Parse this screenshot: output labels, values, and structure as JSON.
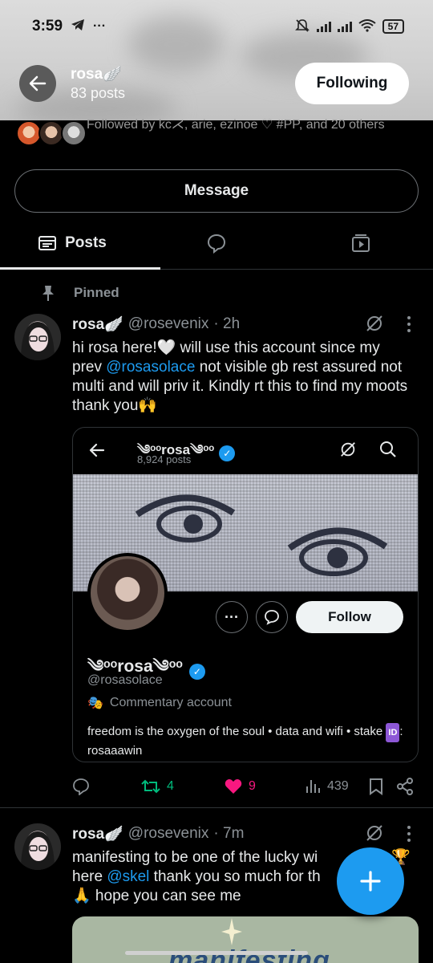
{
  "status_bar": {
    "time": "3:59",
    "battery": "57"
  },
  "header": {
    "name": "rosa🪽",
    "posts_count": "83 posts",
    "following_label": "Following"
  },
  "followed_by": {
    "text": "Followed by kc⋌, arie, ezinoe ♡ #PP, and 20 others"
  },
  "message_label": "Message",
  "tabs": [
    {
      "label": "Posts",
      "active": true
    }
  ],
  "pinned_label": "Pinned",
  "post1": {
    "name": "rosa🪽",
    "handle": "@rosevenix",
    "time": "· 2h",
    "text_a": "hi rosa here!🤍 will use this account since my prev ",
    "mention": "@rosasolace",
    "text_b": " not visible gb rest assured not multi and will priv it. Kindly rt this to find my moots thank you🙌",
    "card": {
      "name": "༄ᵒᵒrosa༄ᵒᵒ",
      "posts": "8,924 posts",
      "follow_label": "Follow",
      "display_name": "༄ᵒᵒrosa༄ᵒᵒ",
      "handle": "@rosasolace",
      "category": "Commentary account",
      "bio_a": "freedom is the oxygen of the soul • data and wifi • stake ",
      "bio_badge": "ID",
      "bio_b": ": rosaaawin"
    },
    "stats": {
      "retweets": "4",
      "likes": "9",
      "views": "439"
    }
  },
  "post2": {
    "name": "rosa🪽",
    "handle": "@rosevenix",
    "time": "· 7m",
    "text_a": "manifesting to be one of the lucky wi",
    "trophy": "🏆",
    "text_b": "here ",
    "mention": "@skel",
    "text_c": " thank you so much for th",
    "text_d": "🙏 hope you can see me",
    "image_text": "manifesting"
  },
  "colors": {
    "accent": "#1d9bf0",
    "like": "#f91880",
    "retweet": "#00ba7c",
    "background": "#000000"
  },
  "icons": [
    "back-arrow-icon",
    "posts-tab-icon",
    "replies-tab-icon",
    "media-tab-icon",
    "pin-icon",
    "grok-icon",
    "more-icon",
    "reply-icon",
    "retweet-icon",
    "heart-icon",
    "views-icon",
    "bookmark-icon",
    "share-icon",
    "plus-icon",
    "verified-icon",
    "search-icon",
    "drama-mask-icon"
  ]
}
